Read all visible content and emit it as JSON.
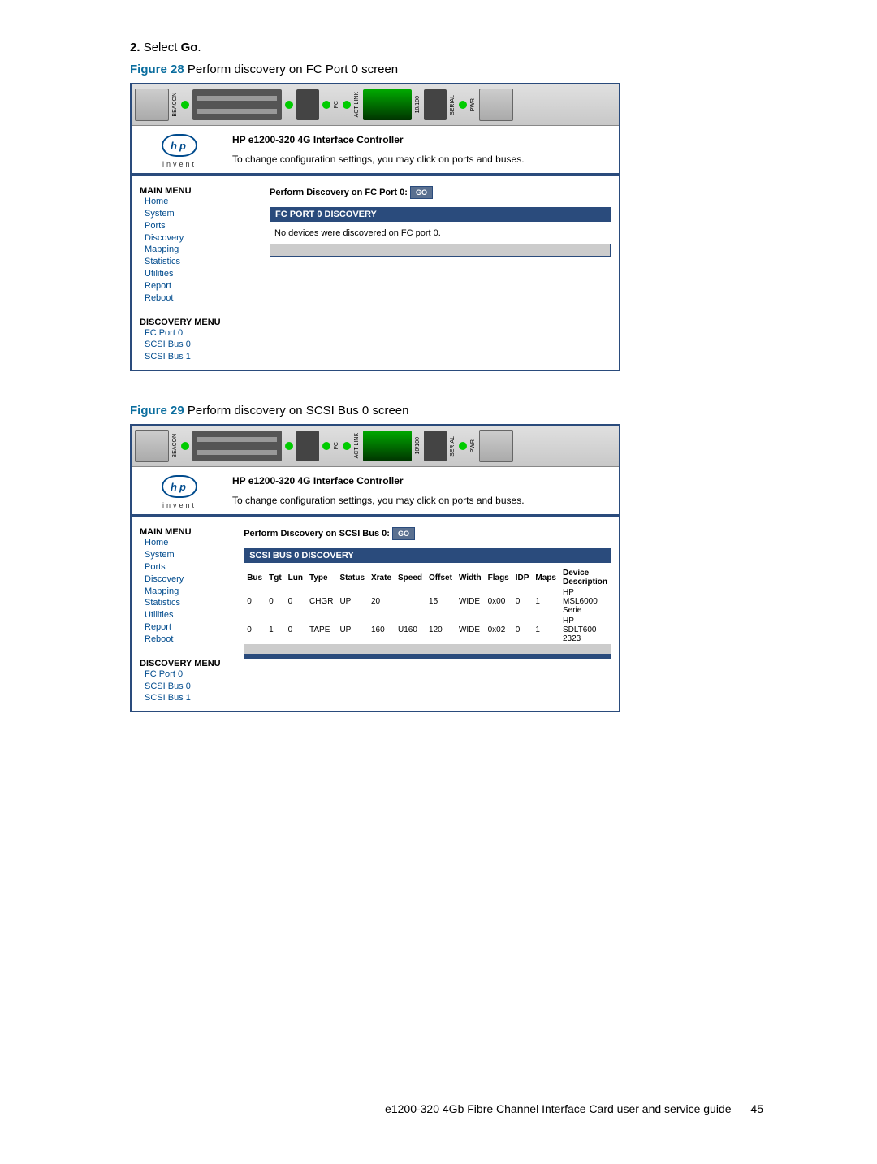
{
  "step": {
    "number": "2.",
    "verb": "Select",
    "target": "Go",
    "period": "."
  },
  "figure28": {
    "label": "Figure 28",
    "caption": "Perform discovery on FC Port 0 screen"
  },
  "figure29": {
    "label": "Figure 29",
    "caption": "Perform discovery on SCSI Bus 0 screen"
  },
  "hp_logo_text": "invent",
  "header": {
    "title": "HP e1200-320 4G Interface Controller",
    "subtitle": "To change configuration settings, you may click on ports and buses."
  },
  "main_menu": {
    "heading": "MAIN MENU",
    "items": [
      "Home",
      "System",
      "Ports",
      "Discovery",
      "Mapping",
      "Statistics",
      "Utilities",
      "Report",
      "Reboot"
    ]
  },
  "discovery_menu": {
    "heading": "DISCOVERY MENU",
    "items": [
      "FC Port 0",
      "SCSI Bus 0",
      "SCSI Bus 1"
    ]
  },
  "fc_panel": {
    "discovery_label": "Perform Discovery on FC Port 0:",
    "go": "GO",
    "title": "FC PORT 0 DISCOVERY",
    "message": "No devices were discovered on FC port 0."
  },
  "scsi_panel": {
    "discovery_label": "Perform Discovery on SCSI Bus 0:",
    "go": "GO",
    "title": "SCSI BUS 0 DISCOVERY",
    "columns": [
      "Bus",
      "Tgt",
      "Lun",
      "Type",
      "Status",
      "Xrate",
      "Speed",
      "Offset",
      "Width",
      "Flags",
      "IDP",
      "Maps",
      "Device Description"
    ],
    "rows": [
      {
        "bus": "0",
        "tgt": "0",
        "lun": "0",
        "type": "CHGR",
        "status": "UP",
        "xrate": "20",
        "speed": "",
        "offset": "15",
        "width": "WIDE",
        "flags": "0x00",
        "idp": "0",
        "maps": "1",
        "desc": "HP MSL6000 Serie"
      },
      {
        "bus": "0",
        "tgt": "1",
        "lun": "0",
        "type": "TAPE",
        "status": "UP",
        "xrate": "160",
        "speed": "U160",
        "offset": "120",
        "width": "WIDE",
        "flags": "0x02",
        "idp": "0",
        "maps": "1",
        "desc": "HP SDLT600 2323"
      }
    ]
  },
  "footer": {
    "text": "e1200-320 4Gb Fibre Channel Interface Card user and service guide",
    "page": "45"
  }
}
